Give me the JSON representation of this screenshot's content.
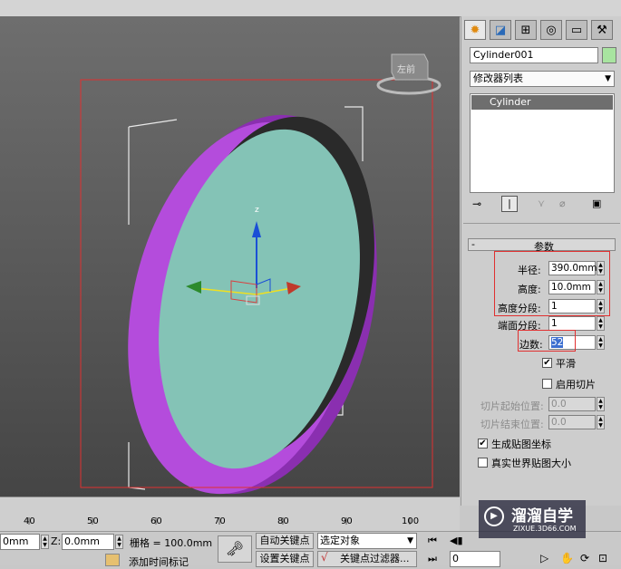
{
  "viewport": {
    "viewcube_label": "左前",
    "gizmo_axis_z": "z"
  },
  "panel": {
    "tabs": [
      "create",
      "modify",
      "hierarchy",
      "motion",
      "display",
      "utilities"
    ],
    "object_name": "Cylinder001",
    "object_color": "#a8e4a0",
    "modifier_list_label": "修改器列表",
    "stack_items": [
      "Cylinder"
    ],
    "params_title": "参数",
    "params_collapse": "-",
    "radius_label": "半径:",
    "radius_value": "390.0mm",
    "height_label": "高度:",
    "height_value": "10.0mm",
    "height_segs_label": "高度分段:",
    "height_segs_value": "1",
    "cap_segs_label": "端面分段:",
    "cap_segs_value": "1",
    "sides_label": "边数:",
    "sides_value": "52",
    "smooth_label": "平滑",
    "smooth_checked": "✔",
    "slice_on_label": "启用切片",
    "slice_from_label": "切片起始位置:",
    "slice_from_value": "0.0",
    "slice_to_label": "切片结束位置:",
    "slice_to_value": "0.0",
    "gen_map_label": "生成贴图坐标",
    "gen_map_checked": "✔",
    "real_world_label": "真实世界贴图大小"
  },
  "ruler": {
    "ticks": [
      "40",
      "50",
      "60",
      "70",
      "80",
      "90",
      "100"
    ]
  },
  "status": {
    "x_value": "0mm",
    "z_label": "Z:",
    "z_value": "0.0mm",
    "grid_label": "栅格 = 100.0mm",
    "add_time_tag": "添加时间标记",
    "auto_key": "自动关键点",
    "set_key": "设置关键点",
    "selection_dropdown": "选定对象",
    "key_filters": "关键点过滤器...",
    "frame_value": "0"
  },
  "watermark": {
    "brand": "溜溜自学",
    "url": "ZIXUE.3D66.COM"
  },
  "colors": {
    "accent_red": "#e03030",
    "selection_blue": "#3c6fd0",
    "cylinder_purple": "#b040d8",
    "cylinder_face": "#84c3b6"
  }
}
